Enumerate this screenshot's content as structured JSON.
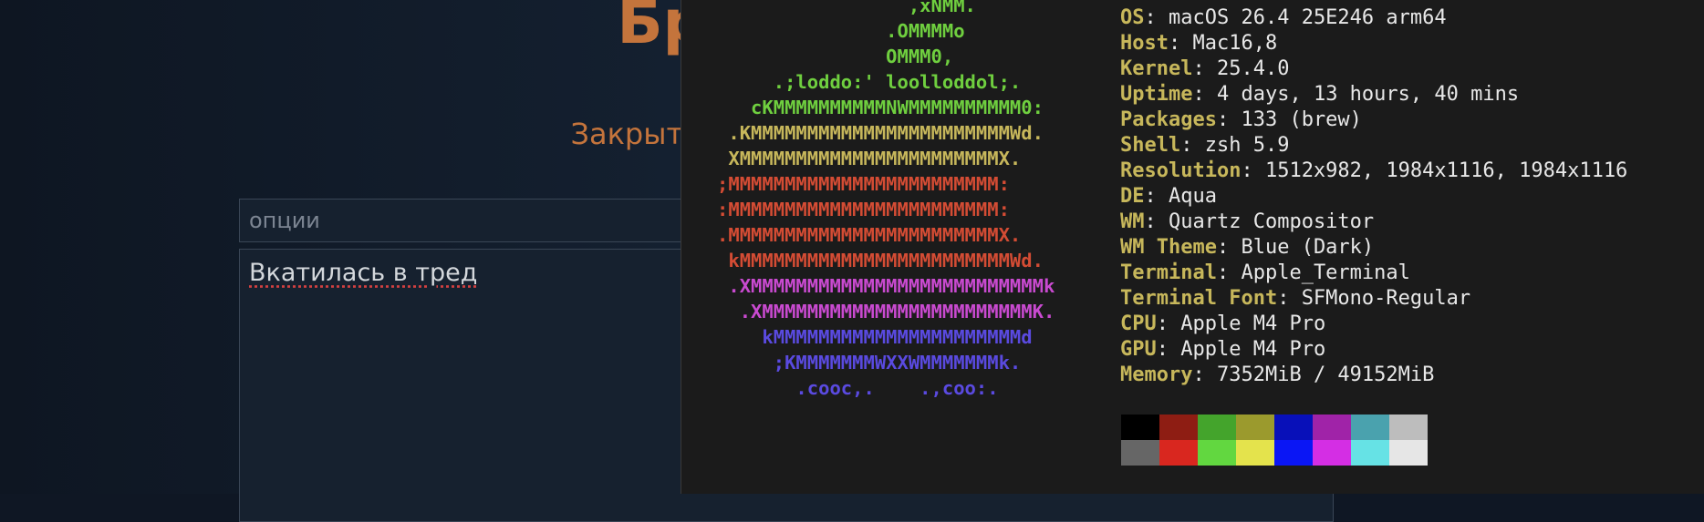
{
  "web_page": {
    "board_title": "Бре",
    "close_form_link": "Закрыть форм",
    "options_placeholder": "опции",
    "message_text": "Вкатилась в тред"
  },
  "terminal": {
    "logo_lines": [
      {
        "text": "                    ,xNMM.",
        "color": "#6fcf3f"
      },
      {
        "text": "                  .OMMMMo",
        "color": "#6fcf3f"
      },
      {
        "text": "                  OMMM0,",
        "color": "#6fcf3f"
      },
      {
        "text": "        .;loddo:' loolloddol;.",
        "color": "#6fcf3f"
      },
      {
        "text": "      cKMMMMMMMMMMNWMMMMMMMMMM0:",
        "color": "#6fcf3f"
      },
      {
        "text": "    .KMMMMMMMMMMMMMMMMMMMMMMMWd.",
        "color": "#c7b75b"
      },
      {
        "text": "    XMMMMMMMMMMMMMMMMMMMMMMMX.",
        "color": "#c7b75b"
      },
      {
        "text": "   ;MMMMMMMMMMMMMMMMMMMMMMMM:",
        "color": "#d44c34"
      },
      {
        "text": "   :MMMMMMMMMMMMMMMMMMMMMMMM:",
        "color": "#d44c34"
      },
      {
        "text": "   .MMMMMMMMMMMMMMMMMMMMMMMMX.",
        "color": "#d44c34"
      },
      {
        "text": "    kMMMMMMMMMMMMMMMMMMMMMMMMWd.",
        "color": "#d44c34"
      },
      {
        "text": "    .XMMMMMMMMMMMMMMMMMMMMMMMMMMk",
        "color": "#c94ad0"
      },
      {
        "text": "     .XMMMMMMMMMMMMMMMMMMMMMMMMK.",
        "color": "#c94ad0"
      },
      {
        "text": "       kMMMMMMMMMMMMMMMMMMMMMMd",
        "color": "#5a4ae0"
      },
      {
        "text": "        ;KMMMMMMMWXXWMMMMMMMk.",
        "color": "#5a4ae0"
      },
      {
        "text": "          .cooc,.    .,coo:.",
        "color": "#5a4ae0"
      }
    ],
    "info_rows": [
      {
        "key": "OS",
        "value": "macOS 26.4 25E246 arm64"
      },
      {
        "key": "Host",
        "value": "Mac16,8"
      },
      {
        "key": "Kernel",
        "value": "25.4.0"
      },
      {
        "key": "Uptime",
        "value": "4 days, 13 hours, 40 mins"
      },
      {
        "key": "Packages",
        "value": "133 (brew)"
      },
      {
        "key": "Shell",
        "value": "zsh 5.9"
      },
      {
        "key": "Resolution",
        "value": "1512x982, 1984x1116, 1984x1116"
      },
      {
        "key": "DE",
        "value": "Aqua"
      },
      {
        "key": "WM",
        "value": "Quartz Compositor"
      },
      {
        "key": "WM Theme",
        "value": "Blue (Dark)"
      },
      {
        "key": "Terminal",
        "value": "Apple_Terminal"
      },
      {
        "key": "Terminal Font",
        "value": "SFMono-Regular"
      },
      {
        "key": "CPU",
        "value": "Apple M4 Pro"
      },
      {
        "key": "GPU",
        "value": "Apple M4 Pro"
      },
      {
        "key": "Memory",
        "value": "7352MiB / 49152MiB"
      }
    ],
    "swatch_colors": [
      "#000000",
      "#8e1d13",
      "#44a42c",
      "#9b9a2d",
      "#0810b9",
      "#a023a8",
      "#4aa2ae",
      "#bdbdbd",
      "#666666",
      "#d9271f",
      "#62d740",
      "#e4e34c",
      "#0a16f5",
      "#d42ee4",
      "#66e2e5",
      "#e6e6e6"
    ]
  }
}
